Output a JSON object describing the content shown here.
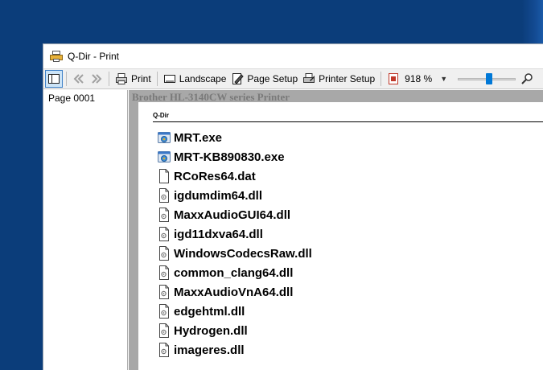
{
  "window": {
    "title": "Q-Dir - Print"
  },
  "toolbar": {
    "print_label": "Print",
    "landscape_label": "Landscape",
    "page_setup_label": "Page Setup",
    "printer_setup_label": "Printer Setup",
    "zoom_value": "918 %",
    "zoom_slider_level": 0.55
  },
  "pages": [
    {
      "label": "Page 0001"
    }
  ],
  "preview": {
    "printer_name": "Brother HL-3140CW series Printer",
    "header": "Q-Dir",
    "files": [
      {
        "name": "MRT.exe",
        "icon": "exe-icon"
      },
      {
        "name": "MRT-KB890830.exe",
        "icon": "exe-icon"
      },
      {
        "name": "RCoRes64.dat",
        "icon": "blank-file-icon"
      },
      {
        "name": "igdumdim64.dll",
        "icon": "dll-file-icon"
      },
      {
        "name": "MaxxAudioGUI64.dll",
        "icon": "dll-file-icon"
      },
      {
        "name": "igd11dxva64.dll",
        "icon": "dll-file-icon"
      },
      {
        "name": "WindowsCodecsRaw.dll",
        "icon": "dll-file-icon"
      },
      {
        "name": "common_clang64.dll",
        "icon": "dll-file-icon"
      },
      {
        "name": "MaxxAudioVnA64.dll",
        "icon": "dll-file-icon"
      },
      {
        "name": "edgehtml.dll",
        "icon": "dll-file-icon"
      },
      {
        "name": "Hydrogen.dll",
        "icon": "dll-file-icon"
      },
      {
        "name": "imageres.dll",
        "icon": "dll-file-icon"
      }
    ]
  }
}
